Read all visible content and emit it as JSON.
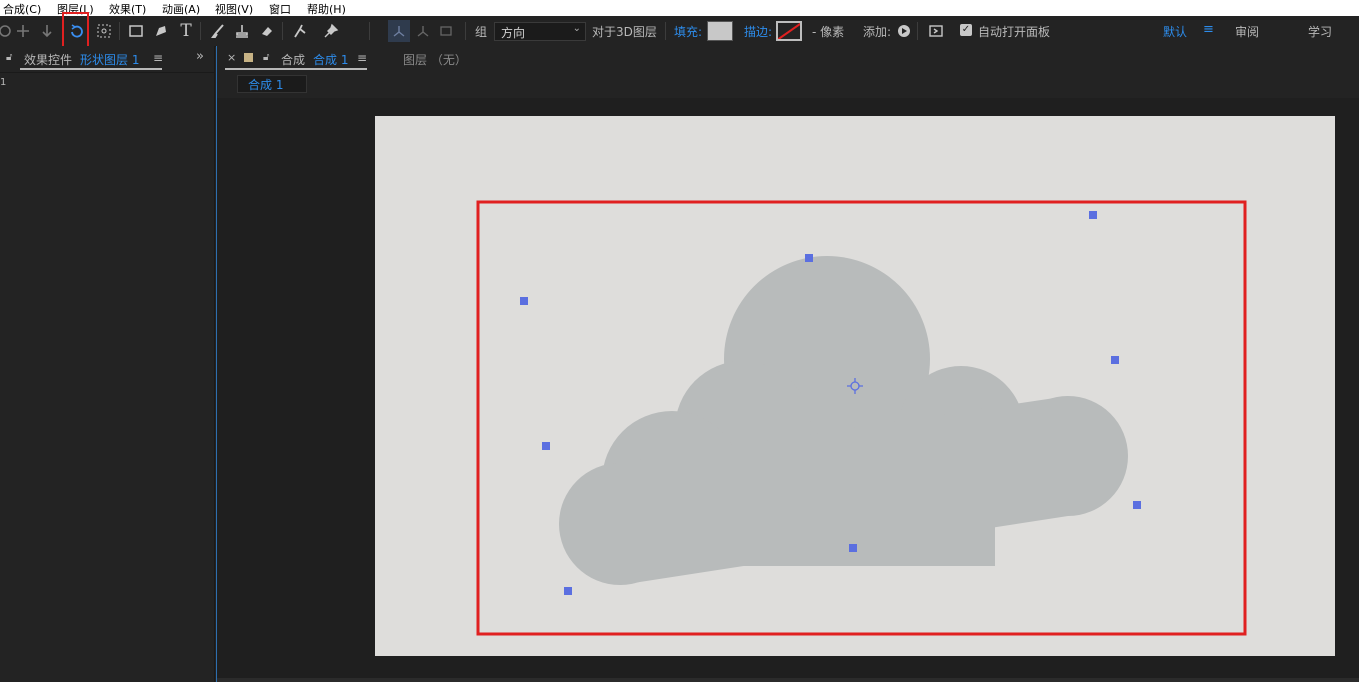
{
  "menu": {
    "items": [
      "合成(C)",
      "图层(L)",
      "效果(T)",
      "动画(A)",
      "视图(V)",
      "窗口",
      "帮助(H)"
    ]
  },
  "toolbar": {
    "group_label": "组",
    "direction_value": "方向",
    "align_3d_label": "对于3D图层",
    "fill_label": "填充:",
    "stroke_label": "描边:",
    "pixels_label": "- 像素",
    "add_label": "添加:",
    "auto_open_label": "自动打开面板",
    "workspace_default": "默认",
    "workspace_review": "审阅",
    "workspace_learn": "学习",
    "colors": {
      "fill": "#c8c8c8",
      "stroke_none": "#e02020",
      "accent": "#2d8ceb"
    },
    "icons": [
      "orbit-icon",
      "pan-icon",
      "dolly-icon",
      "rotation-tool-icon",
      "anchor-point-icon",
      "rectangle-tool-icon",
      "pen-tool-icon",
      "type-tool-icon",
      "brush-tool-icon",
      "clone-stamp-icon",
      "eraser-icon",
      "roto-brush-icon",
      "puppet-pin-icon"
    ]
  },
  "effects_panel": {
    "tab_prefix": "效果控件",
    "tab_layer": "形状图层 1",
    "content_line": "1"
  },
  "composition_panel": {
    "tab_prefix": "合成",
    "tab_name": "合成 1",
    "layer_tab": "图层 （无）",
    "sub_tab": "合成 1"
  },
  "canvas": {
    "background": "#dedddb",
    "shape_color": "#b8bbbb",
    "handle_color": "#5b6fe0",
    "selection_color": "#e02020"
  }
}
